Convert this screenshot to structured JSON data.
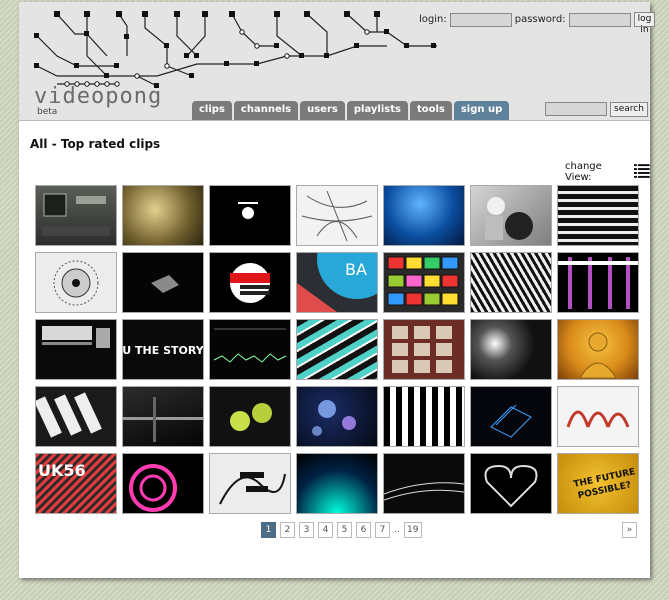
{
  "logo": {
    "text": "videopong",
    "beta": "beta"
  },
  "login": {
    "login_label": "login:",
    "password_label": "password:",
    "login_value": "",
    "password_value": "",
    "button": "log in"
  },
  "nav": {
    "tabs": [
      {
        "label": "clips",
        "active": false
      },
      {
        "label": "channels",
        "active": false
      },
      {
        "label": "users",
        "active": false
      },
      {
        "label": "playlists",
        "active": false
      },
      {
        "label": "tools",
        "active": false
      },
      {
        "label": "sign up",
        "active": true
      }
    ]
  },
  "search": {
    "value": "",
    "button": "search"
  },
  "main": {
    "title": "All - Top rated clips",
    "change_view_label": "change View:",
    "change_view_icon": "list-view-icon"
  },
  "pagination": {
    "pages": [
      "1",
      "2",
      "3",
      "4",
      "5",
      "6",
      "7"
    ],
    "ellipsis": "..",
    "last": "19",
    "next": "»",
    "current": "1"
  }
}
